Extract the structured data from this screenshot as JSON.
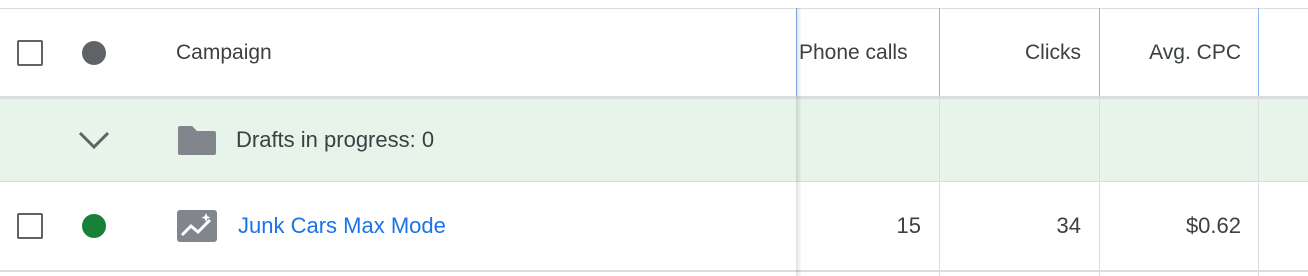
{
  "header": {
    "campaign_label": "Campaign",
    "phone_calls_label": "Phone calls",
    "clicks_label": "Clicks",
    "avg_cpc_label": "Avg. CPC",
    "status_dot_color": "#5f6368"
  },
  "drafts_row": {
    "label": "Drafts in progress: 0",
    "background": "#e6f4ea",
    "expanded": true
  },
  "campaigns": [
    {
      "name": "Junk Cars Max Mode",
      "status": "enabled",
      "status_color": "#188038",
      "type_icon": "performance-max-icon",
      "phone_calls": "15",
      "clicks": "34",
      "avg_cpc": "$0.62"
    }
  ]
}
